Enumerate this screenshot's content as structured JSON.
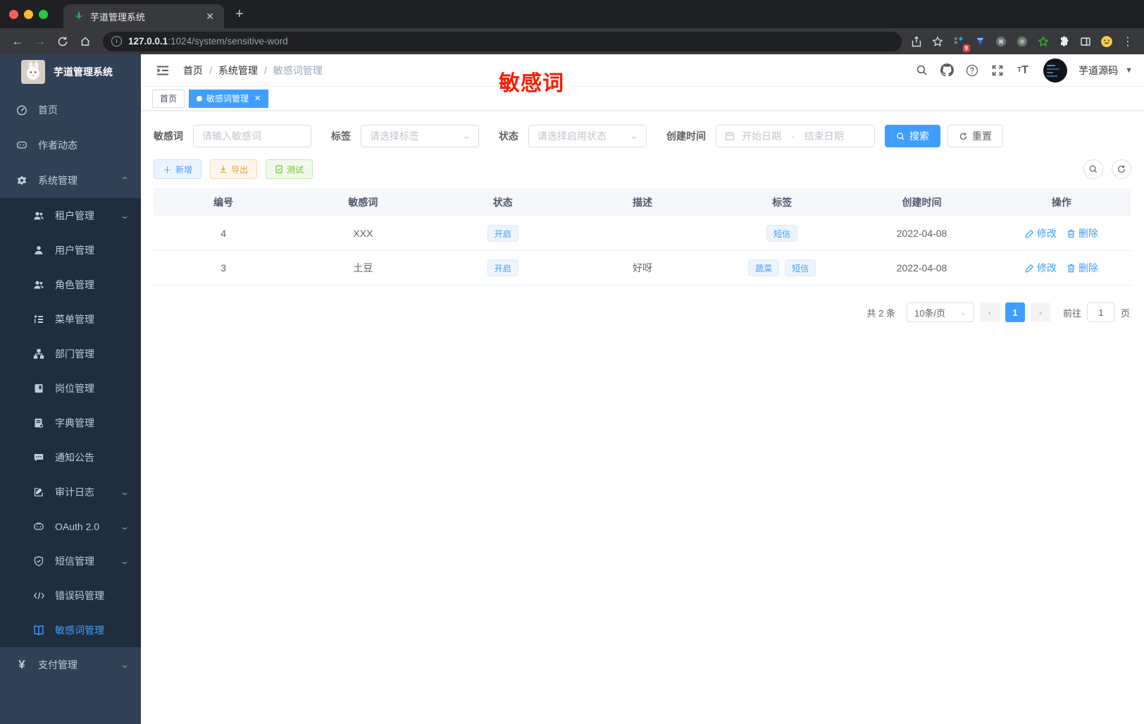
{
  "colors": {
    "accent": "#409eff",
    "annotation_red": "#f81d06",
    "sidebar_bg": "#304156",
    "submenu_bg": "#1f2d3d",
    "tag_active": "#409eff"
  },
  "browser": {
    "tab_title": "芋道管理系统",
    "url_host": "127.0.0.1",
    "url_rest": ":1024/system/sensitive-word",
    "extension_badge": "9"
  },
  "sidebar": {
    "app_title": "芋道管理系统",
    "items": [
      {
        "key": "home",
        "label": "首页",
        "icon": "dashboard-icon",
        "level": 0,
        "arrow": "",
        "active": false
      },
      {
        "key": "author-updates",
        "label": "作者动态",
        "icon": "chat-icon",
        "level": 0,
        "arrow": "",
        "active": false
      },
      {
        "key": "system-management",
        "label": "系统管理",
        "icon": "gear-icon",
        "level": 0,
        "arrow": "up",
        "active": false
      },
      {
        "key": "tenant-management",
        "label": "租户管理",
        "icon": "users-icon",
        "level": 1,
        "arrow": "down",
        "active": false
      },
      {
        "key": "user-management",
        "label": "用户管理",
        "icon": "user-icon",
        "level": 1,
        "arrow": "",
        "active": false
      },
      {
        "key": "role-management",
        "label": "角色管理",
        "icon": "users-icon",
        "level": 1,
        "arrow": "",
        "active": false
      },
      {
        "key": "menu-management",
        "label": "菜单管理",
        "icon": "tree-list-icon",
        "level": 1,
        "arrow": "",
        "active": false
      },
      {
        "key": "department-management",
        "label": "部门管理",
        "icon": "org-tree-icon",
        "level": 1,
        "arrow": "",
        "active": false
      },
      {
        "key": "position-management",
        "label": "岗位管理",
        "icon": "badge-icon",
        "level": 1,
        "arrow": "",
        "active": false
      },
      {
        "key": "dict-management",
        "label": "字典管理",
        "icon": "book-icon",
        "level": 1,
        "arrow": "",
        "active": false
      },
      {
        "key": "notice-announcement",
        "label": "通知公告",
        "icon": "message-icon",
        "level": 1,
        "arrow": "",
        "active": false
      },
      {
        "key": "audit-log",
        "label": "审计日志",
        "icon": "edit-note-icon",
        "level": 1,
        "arrow": "down",
        "active": false
      },
      {
        "key": "oauth2",
        "label": "OAuth 2.0",
        "icon": "robot-icon",
        "level": 1,
        "arrow": "down",
        "active": false
      },
      {
        "key": "sms-management",
        "label": "短信管理",
        "icon": "shield-icon",
        "level": 1,
        "arrow": "down",
        "active": false
      },
      {
        "key": "error-code-management",
        "label": "错误码管理",
        "icon": "code-icon",
        "level": 1,
        "arrow": "",
        "active": false
      },
      {
        "key": "sensitive-word-management",
        "label": "敏感词管理",
        "icon": "book-open-icon",
        "level": 1,
        "arrow": "",
        "active": true
      },
      {
        "key": "payment-management",
        "label": "支付管理",
        "icon": "yen-icon",
        "level": 0,
        "arrow": "down",
        "active": false
      }
    ]
  },
  "header": {
    "breadcrumb": [
      "首页",
      "系统管理",
      "敏感词管理"
    ],
    "annotation": "敏感词",
    "user_name": "芋道源码"
  },
  "tags": [
    {
      "label": "首页",
      "active": false,
      "closable": false
    },
    {
      "label": "敏感词管理",
      "active": true,
      "closable": true
    }
  ],
  "filters": {
    "keyword_label": "敏感词",
    "keyword_placeholder": "请输入敏感词",
    "tag_label": "标签",
    "tag_placeholder": "请选择标签",
    "status_label": "状态",
    "status_placeholder": "请选择启用状态",
    "date_label": "创建时间",
    "date_start_placeholder": "开始日期",
    "date_separator": "-",
    "date_end_placeholder": "结束日期",
    "search_label": "搜索",
    "reset_label": "重置"
  },
  "toolbar": {
    "add_label": "新增",
    "export_label": "导出",
    "test_label": "测试"
  },
  "table": {
    "columns": [
      "编号",
      "敏感词",
      "状态",
      "描述",
      "标签",
      "创建时间",
      "操作"
    ],
    "edit_label": "修改",
    "delete_label": "删除",
    "rows": [
      {
        "id": "4",
        "word": "XXX",
        "status": "开启",
        "description": "",
        "tags": [
          "短信"
        ],
        "created": "2022-04-08"
      },
      {
        "id": "3",
        "word": "土豆",
        "status": "开启",
        "description": "好呀",
        "tags": [
          "蔬菜",
          "短信"
        ],
        "created": "2022-04-08"
      }
    ]
  },
  "pagination": {
    "total_text": "共 2 条",
    "page_size_text": "10条/页",
    "current_page": "1",
    "goto_label": "前往",
    "goto_value": "1",
    "page_suffix": "页"
  }
}
